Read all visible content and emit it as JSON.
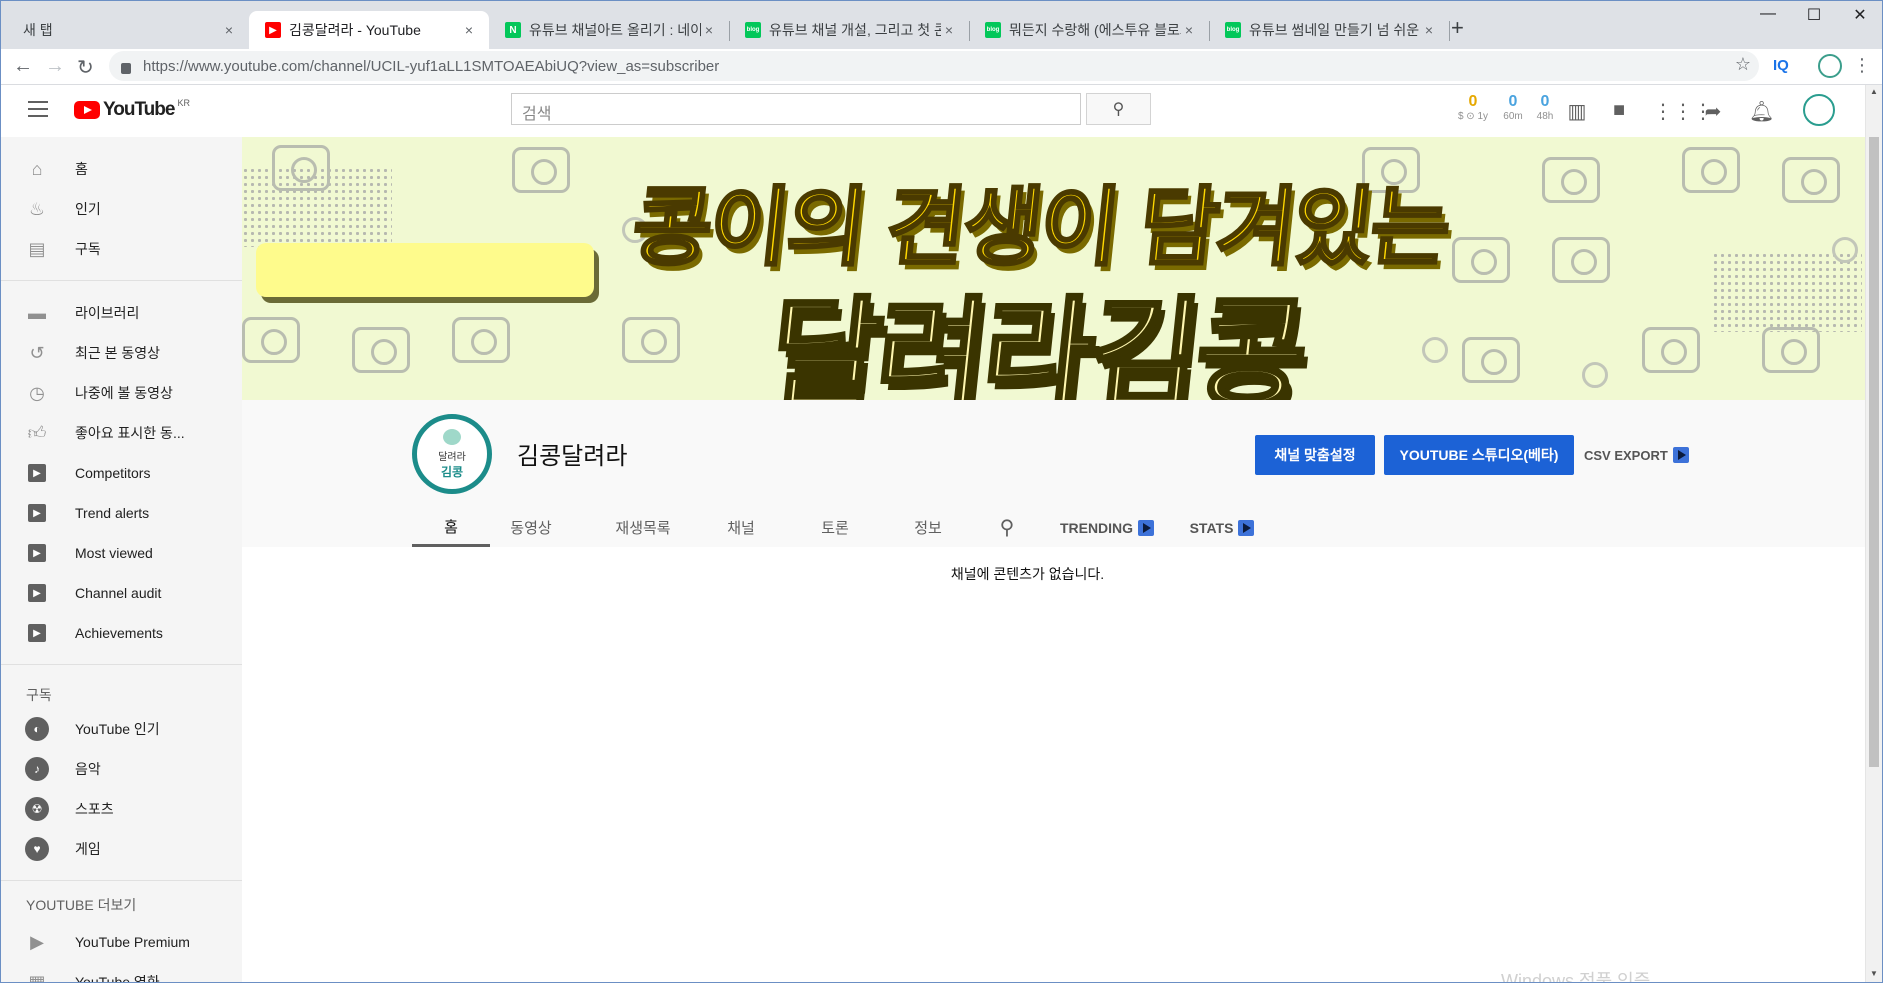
{
  "browser": {
    "tabs": [
      {
        "title": "새 탭",
        "favicon": "none"
      },
      {
        "title": "김콩달려라 - YouTube",
        "favicon": "youtube-icon"
      },
      {
        "title": "유튜브 채널아트 올리기 : 네이버",
        "favicon": "naver-icon"
      },
      {
        "title": "유튜브 채널 개설, 그리고 첫 콘텐",
        "favicon": "blog-icon"
      },
      {
        "title": "뭐든지 수랑해 (에스투유 블로그",
        "favicon": "blog-icon"
      },
      {
        "title": "유튜브 썸네일 만들기 넘 쉬운 방",
        "favicon": "blog-icon"
      }
    ],
    "tab_close_glyph": "×",
    "new_tab_glyph": "+",
    "url": "https://www.youtube.com/channel/UCIL-yuf1aLL1SMTOAEAbiUQ?view_as=subscriber",
    "extension_label": "IQ"
  },
  "youtube": {
    "logo_text": "YouTube",
    "logo_region": "KR",
    "search_placeholder": "검색",
    "stats": [
      {
        "value": "0",
        "label": "$ ⊙ 1y",
        "color": "#e6a800"
      },
      {
        "value": "0",
        "label": "60m",
        "color": "#4aa3df"
      },
      {
        "value": "0",
        "label": "48h",
        "color": "#4aa3df"
      }
    ]
  },
  "sidebar": {
    "main": [
      {
        "label": "홈",
        "icon": "home-icon"
      },
      {
        "label": "인기",
        "icon": "fire-icon"
      },
      {
        "label": "구독",
        "icon": "subscriptions-icon"
      }
    ],
    "library": [
      {
        "label": "라이브러리",
        "icon": "folder-icon"
      },
      {
        "label": "최근 본 동영상",
        "icon": "history-icon"
      },
      {
        "label": "나중에 볼 동영상",
        "icon": "clock-icon"
      },
      {
        "label": "좋아요 표시한 동...",
        "icon": "thumbs-up-icon"
      },
      {
        "label": "Competitors",
        "icon": "vidiq-icon"
      },
      {
        "label": "Trend alerts",
        "icon": "vidiq-icon"
      },
      {
        "label": "Most viewed",
        "icon": "vidiq-icon"
      },
      {
        "label": "Channel audit",
        "icon": "vidiq-icon"
      },
      {
        "label": "Achievements",
        "icon": "vidiq-icon"
      }
    ],
    "subscriptions_heading": "구독",
    "subscriptions": [
      {
        "label": "YouTube 인기",
        "icon": "trending-channel-icon"
      },
      {
        "label": "음악",
        "icon": "music-icon"
      },
      {
        "label": "스포츠",
        "icon": "sports-icon"
      },
      {
        "label": "게임",
        "icon": "gaming-icon"
      }
    ],
    "more_heading": "YOUTUBE 더보기",
    "more": [
      {
        "label": "YouTube Premium",
        "icon": "youtube-premium-icon"
      },
      {
        "label": "YouTube 영화",
        "icon": "movies-icon"
      }
    ]
  },
  "channel": {
    "banner_line1": "콩이의 견생이 담겨있는",
    "banner_line2": "달려라김콩",
    "avatar_line1": "달려라",
    "avatar_line2": "김콩",
    "name": "김콩달려라",
    "customize_button": "채널 맞춤설정",
    "studio_button": "YOUTUBE 스튜디오(베타)",
    "csv_export": "CSV EXPORT",
    "tabs": [
      "홈",
      "동영상",
      "재생목록",
      "채널",
      "토론",
      "정보"
    ],
    "extra_tabs": [
      "TRENDING",
      "STATS"
    ],
    "empty_message": "채널에 콘텐츠가 없습니다."
  },
  "watermark": "Windows 정품 인증"
}
